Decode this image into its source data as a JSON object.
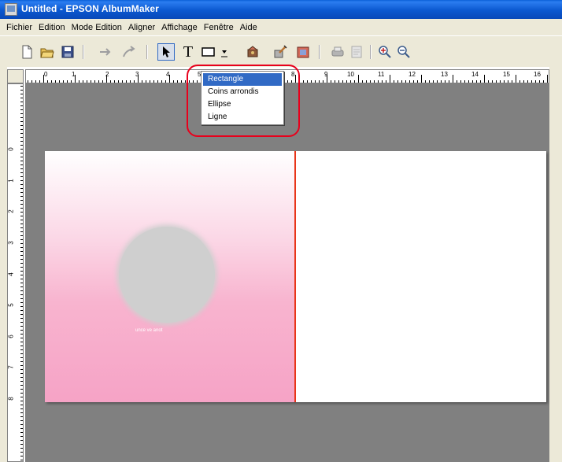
{
  "window": {
    "title": "Untitled - EPSON AlbumMaker",
    "icon": "album-app-icon"
  },
  "menubar": {
    "items": [
      "Fichier",
      "Edition",
      "Mode Edition",
      "Aligner",
      "Affichage",
      "Fenêtre",
      "Aide"
    ]
  },
  "toolbar": {
    "buttons": [
      {
        "name": "new-icon"
      },
      {
        "name": "open-icon"
      },
      {
        "name": "save-icon"
      },
      {
        "name": "undo-icon"
      },
      {
        "name": "redo-icon"
      },
      {
        "name": "select-arrow-icon"
      },
      {
        "name": "text-tool-icon"
      },
      {
        "name": "shape-tool-icon"
      },
      {
        "name": "shape-dropdown-icon"
      },
      {
        "name": "clipart-icon"
      },
      {
        "name": "edit-image-icon"
      },
      {
        "name": "layout-icon"
      },
      {
        "name": "print-icon"
      },
      {
        "name": "preview-icon"
      },
      {
        "name": "zoom-in-icon"
      },
      {
        "name": "zoom-out-icon"
      }
    ],
    "text_tool_label": "T"
  },
  "shape_menu": {
    "options": [
      "Rectangle",
      "Coins arrondis",
      "Ellipse",
      "Ligne"
    ],
    "selected": "Rectangle"
  },
  "horizontal_ruler": {
    "numbers": [
      "0",
      "1",
      "2",
      "3",
      "4",
      "5",
      "8",
      "9",
      "10",
      "11",
      "12",
      "13",
      "14",
      "15",
      "16"
    ]
  },
  "vertical_ruler": {
    "numbers": [
      "0",
      "1",
      "2",
      "3",
      "4",
      "5",
      "6",
      "7",
      "8"
    ]
  },
  "canvas": {
    "caption": "unce ve anot"
  },
  "colors": {
    "titlebar": "#0a5fd8",
    "chrome": "#ece9d8",
    "workspace": "#808080",
    "page_pink": "#f6a3c6",
    "spine": "#e8351a",
    "highlight": "#316ac5",
    "callout": "#e8001c"
  }
}
